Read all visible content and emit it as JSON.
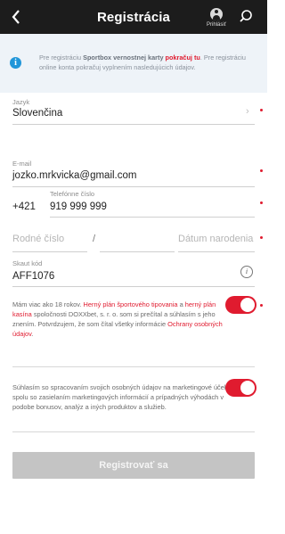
{
  "header": {
    "back_icon": "chevron-left-icon",
    "title": "Registrácia",
    "login_label": "Prihlásiť",
    "search_icon": "search-icon"
  },
  "info": {
    "text_before": "Pre registráciu ",
    "brand": "Sportbox vernostnej karty",
    "link": "pokračuj tu",
    "text_after": ". Pre registráciu online konta pokračuj vyplnením nasledujúcich údajov."
  },
  "form": {
    "language": {
      "label": "Jazyk",
      "value": "Slovenčina"
    },
    "email": {
      "label": "E-mail",
      "value": "jozko.mrkvicka@gmail.com"
    },
    "phone": {
      "prefix": "+421",
      "label": "Telefónne číslo",
      "value": "919 999 999"
    },
    "birth": {
      "id_placeholder": "Rodné číslo",
      "separator": "/",
      "date_placeholder": "Dátum narodenia"
    },
    "scout": {
      "label": "Skaut kód",
      "value": "AFF1076"
    }
  },
  "consent1": {
    "t1": "Mám viac ako 18 rokov. ",
    "l1": "Herný plán športového tipovania",
    "t2": " a ",
    "l2": "herný plán kasína",
    "t3": " spoločnosti DOXXbet, s. r. o. som si prečítal a súhlasím s jeho znením. Potvrdzujem, že som čítal všetky informácie ",
    "l3": "Ochrany osobných údajov",
    "t4": "."
  },
  "consent2": {
    "text": "Súhlasím so spracovaním svojich osobných údajov na marketingové účely spolu so zasielaním marketingových informácií a prípadných výhodách v podobe bonusov, analýz a iných produktov a služieb."
  },
  "submit_label": "Registrovať sa",
  "colors": {
    "accent": "#e01b2f",
    "header": "#1c1c1c",
    "info_bg": "#eef3f8"
  }
}
